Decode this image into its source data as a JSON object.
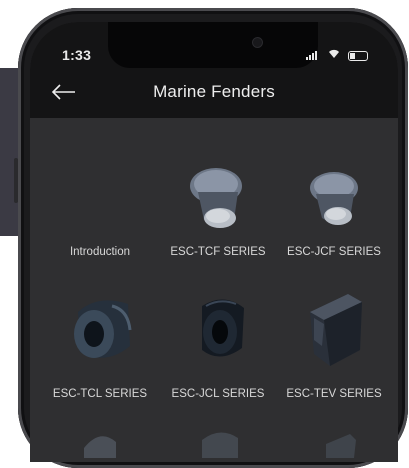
{
  "status_bar": {
    "time": "1:33"
  },
  "header": {
    "title": "Marine Fenders",
    "back_icon": "arrow-left-icon"
  },
  "grid": {
    "items": [
      {
        "label": "Introduction",
        "icon": "none"
      },
      {
        "label": "ESC-TCF SERIES",
        "icon": "cone-fender-icon"
      },
      {
        "label": "ESC-JCF SERIES",
        "icon": "cone-fender-icon"
      },
      {
        "label": "ESC-TCL SERIES",
        "icon": "cylinder-fender-icon"
      },
      {
        "label": "ESC-JCL SERIES",
        "icon": "cylinder-fender-icon"
      },
      {
        "label": "ESC-TEV SERIES",
        "icon": "wedge-fender-icon"
      }
    ]
  },
  "colors": {
    "background": "#2f2f31",
    "bar": "#141415",
    "text": "#d8d8d8"
  }
}
